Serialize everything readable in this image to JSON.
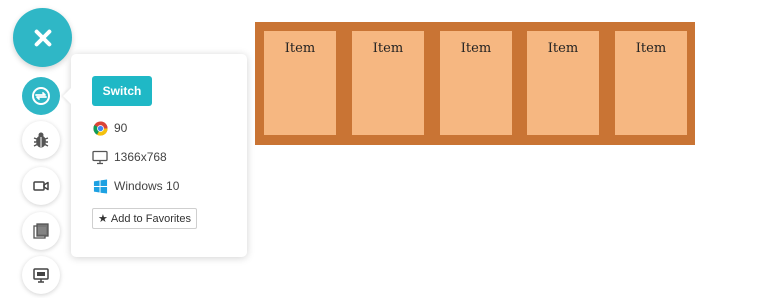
{
  "panel": {
    "switch_label": "Switch",
    "browser_version": "90",
    "resolution": "1366x768",
    "os": "Windows 10",
    "favorite_label": "Add to Favorites"
  },
  "items": [
    {
      "label": "Item"
    },
    {
      "label": "Item"
    },
    {
      "label": "Item"
    },
    {
      "label": "Item"
    },
    {
      "label": "Item"
    }
  ],
  "colors": {
    "accent": "#2fb7c6",
    "container": "#c97434",
    "item": "#f6b781"
  },
  "icons": [
    "close-icon",
    "switch-browser-icon",
    "bug-icon",
    "video-icon",
    "gallery-icon",
    "monitor-icon",
    "chrome-icon",
    "desktop-icon",
    "windows-icon",
    "star-icon"
  ]
}
